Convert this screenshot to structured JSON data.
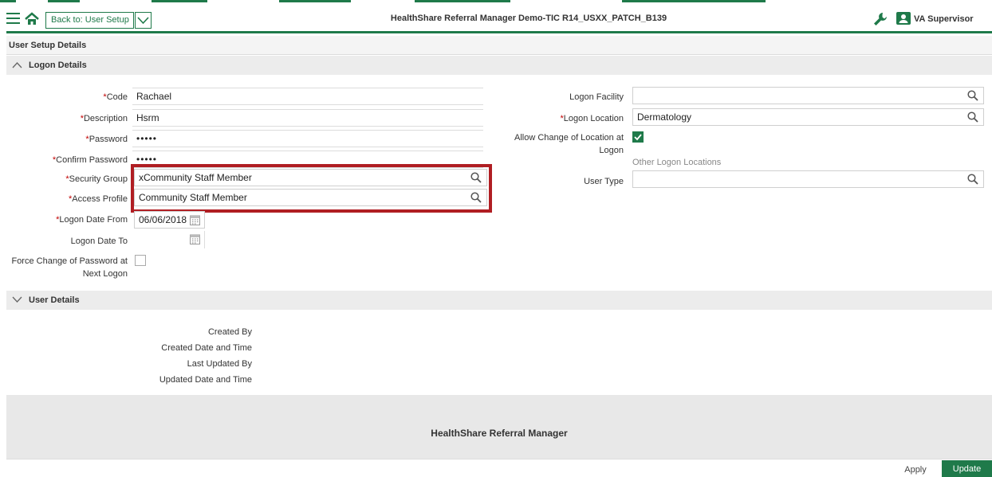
{
  "header": {
    "back_button_label": "Back to: User Setup",
    "app_title": "HealthShare Referral Manager Demo-TIC R14_USXX_PATCH_B139",
    "user_name": "VA Supervisor"
  },
  "page_title": "User Setup Details",
  "logon_section": {
    "title": "Logon Details",
    "code_label": "Code",
    "code_value": "Rachael",
    "description_label": "Description",
    "description_value": "Hsrm",
    "password_label": "Password",
    "password_value": "•••••",
    "confirm_password_label": "Confirm Password",
    "confirm_password_value": "•••••",
    "security_group_label": "Security Group",
    "security_group_value": "xCommunity Staff Member",
    "access_profile_label": "Access Profile",
    "access_profile_value": "Community Staff Member",
    "logon_date_from_label": "Logon Date From",
    "logon_date_from_value": "06/06/2018",
    "logon_date_to_label": "Logon Date To",
    "logon_date_to_value": "",
    "force_change_label_1": "Force Change of Password at",
    "force_change_label_2": "Next Logon",
    "force_change_checked": false,
    "logon_facility_label": "Logon Facility",
    "logon_facility_value": "",
    "logon_location_label": "Logon Location",
    "logon_location_value": "Dermatology",
    "allow_change_label_1": "Allow Change of Location at",
    "allow_change_label_2": "Logon",
    "allow_change_checked": true,
    "other_locations_label": "Other Logon Locations",
    "user_type_label": "User Type",
    "user_type_value": ""
  },
  "user_details_section": {
    "title": "User Details",
    "created_by_label": "Created By",
    "created_date_label": "Created Date and Time",
    "last_updated_by_label": "Last Updated By",
    "updated_date_label": "Updated Date and Time"
  },
  "footer": {
    "brand": "HealthShare Referral Manager",
    "apply_label": "Apply",
    "update_label": "Update"
  },
  "colors": {
    "accent": "#1f7a4a",
    "required": "#c00000",
    "highlight_border": "#b01e23"
  },
  "icons": [
    "menu-icon",
    "home-icon",
    "chevron-down-icon",
    "wrench-icon",
    "user-card-icon",
    "search-icon",
    "calendar-icon",
    "check-icon",
    "chevron-up-icon"
  ]
}
